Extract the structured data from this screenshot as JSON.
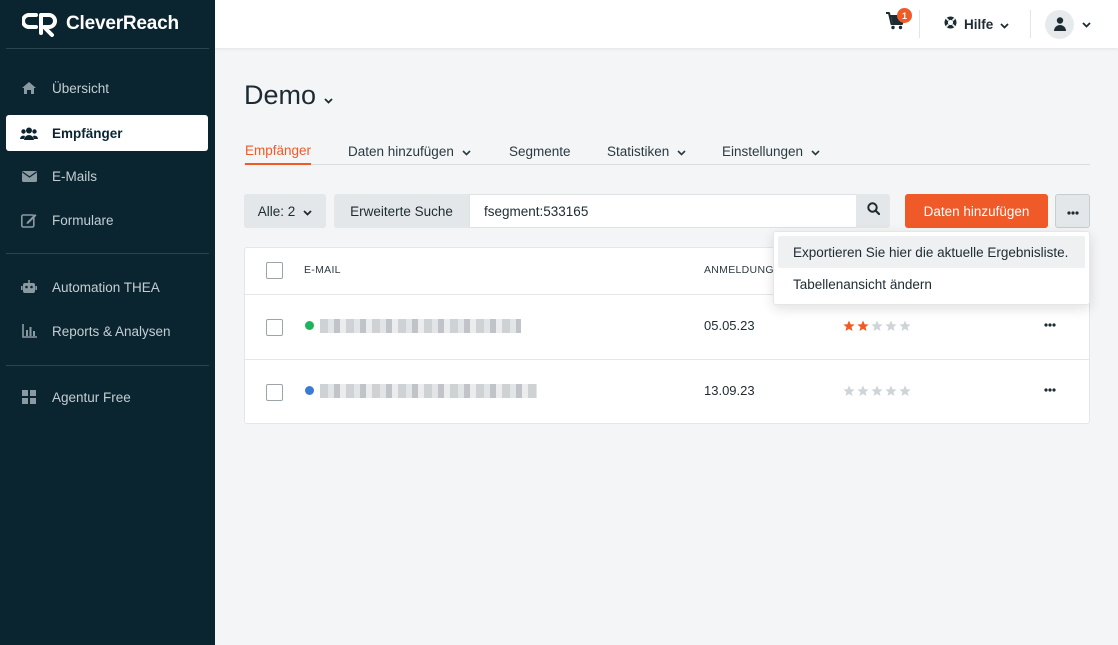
{
  "brand": {
    "name": "CleverReach",
    "accent": "#f05a28",
    "sidebar_bg": "#0b2530"
  },
  "sidebar": {
    "items": [
      {
        "label": "Übersicht",
        "icon": "home-icon"
      },
      {
        "label": "Empfänger",
        "icon": "users-icon",
        "active": true
      },
      {
        "label": "E-Mails",
        "icon": "envelope-icon"
      },
      {
        "label": "Formulare",
        "icon": "edit-form-icon"
      },
      {
        "label": "Automation THEA",
        "icon": "robot-icon"
      },
      {
        "label": "Reports & Analysen",
        "icon": "bar-chart-icon"
      },
      {
        "label": "Agentur Free",
        "icon": "grid-icon"
      }
    ]
  },
  "topbar": {
    "cart_count": "1",
    "help_label": "Hilfe"
  },
  "main": {
    "title": "Demo",
    "tabs": [
      {
        "label": "Empfänger",
        "active": true,
        "dropdown": false
      },
      {
        "label": "Daten hinzufügen",
        "dropdown": true
      },
      {
        "label": "Segmente",
        "dropdown": false
      },
      {
        "label": "Statistiken",
        "dropdown": true
      },
      {
        "label": "Einstellungen",
        "dropdown": true
      }
    ],
    "filter": {
      "all_label": "Alle: 2",
      "advanced_search_label": "Erweiterte Suche",
      "search_value": "fsegment:533165"
    },
    "add_data_button": "Daten hinzufügen",
    "more_menu": {
      "items": [
        {
          "label": "Exportieren Sie hier die aktuelle Ergebnisliste.",
          "hover": true
        },
        {
          "label": "Tabellenansicht ändern"
        }
      ]
    },
    "table": {
      "columns": [
        "E-MAIL",
        "ANMELDUNG"
      ],
      "rows": [
        {
          "status_color": "#1fb35a",
          "email": "[redacted]",
          "date": "05.05.23",
          "rating": 2
        },
        {
          "status_color": "#3a7bd5",
          "email": "[redacted]",
          "date": "13.09.23",
          "rating": 0
        }
      ]
    }
  }
}
